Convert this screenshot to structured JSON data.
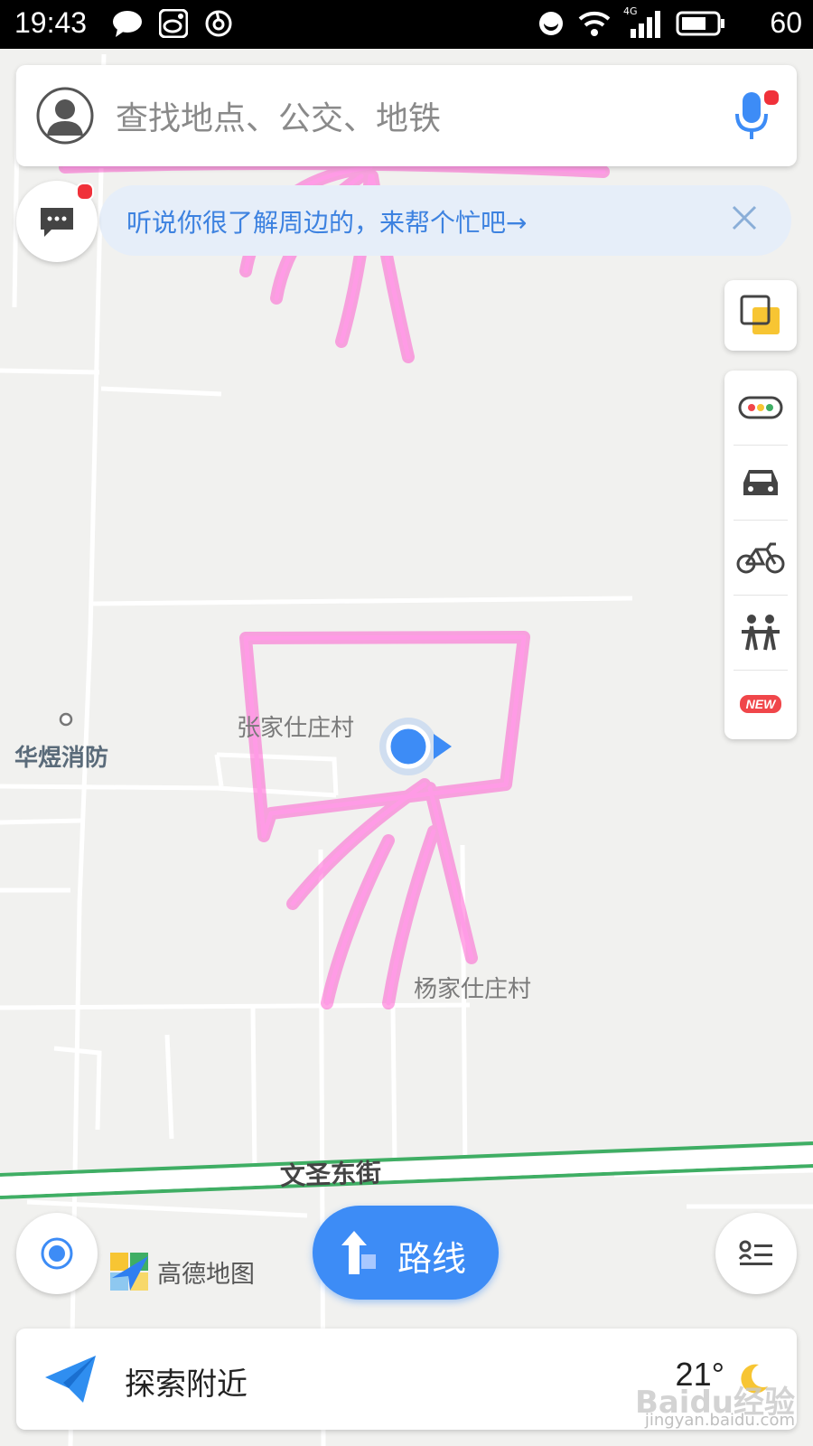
{
  "status_bar": {
    "time": "19:43",
    "network": "4G",
    "battery": "60"
  },
  "search": {
    "placeholder": "查找地点、公交、地铁"
  },
  "notice": {
    "text": "听说你很了解周边的，来帮个忙吧→"
  },
  "tools": [
    {
      "icon": "layers-icon"
    },
    {
      "icon": "traffic-light-icon"
    },
    {
      "icon": "taxi-icon"
    },
    {
      "icon": "bicycle-icon"
    },
    {
      "icon": "people-icon"
    },
    {
      "badge": "NEW"
    }
  ],
  "map": {
    "villages": [
      "张家仕庄村",
      "杨家仕庄村"
    ],
    "poi": "华煜消防",
    "street": "文圣东街"
  },
  "route_button": {
    "label": "路线"
  },
  "logo": {
    "text": "高德地图"
  },
  "explore": {
    "label": "探索附近",
    "temperature": "21°"
  },
  "watermark": {
    "brand": "Baidu经验",
    "url": "jingyan.baidu.com"
  },
  "colors": {
    "accent": "#3d8cf6",
    "annotation": "#ff3fc8",
    "road_green": "#3fae64"
  }
}
